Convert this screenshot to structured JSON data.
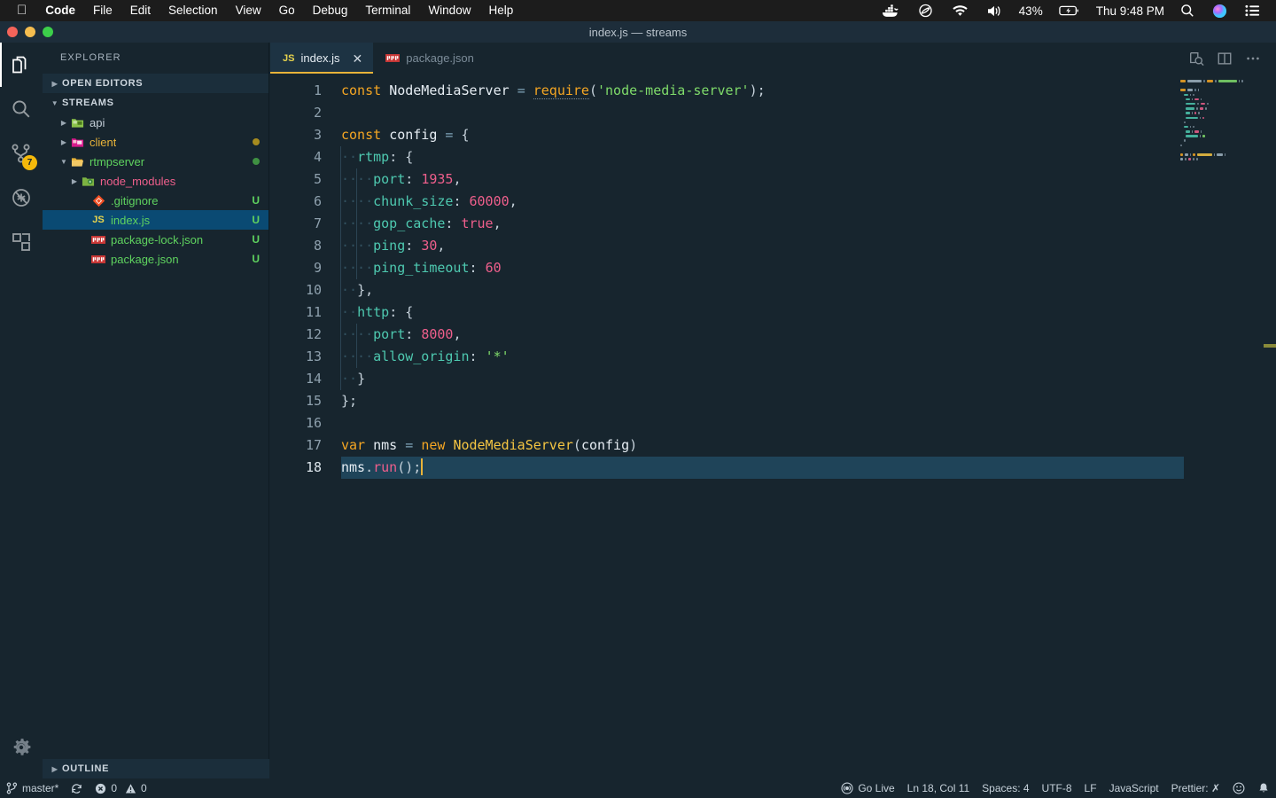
{
  "macos_menubar": {
    "apple_icon": "apple-icon",
    "items": [
      {
        "label": "Code",
        "bold": true
      },
      {
        "label": "File",
        "bold": false
      },
      {
        "label": "Edit",
        "bold": false
      },
      {
        "label": "Selection",
        "bold": false
      },
      {
        "label": "View",
        "bold": false
      },
      {
        "label": "Go",
        "bold": false
      },
      {
        "label": "Debug",
        "bold": false
      },
      {
        "label": "Terminal",
        "bold": false
      },
      {
        "label": "Window",
        "bold": false
      },
      {
        "label": "Help",
        "bold": false
      }
    ],
    "status_icons": [
      "docker-icon",
      "creative-cloud-icon",
      "wifi-icon",
      "volume-icon"
    ],
    "battery_percent": "43%",
    "battery_icon": "battery-charging-icon",
    "clock": "Thu 9:48 PM",
    "right_icons": [
      "spotlight-search-icon",
      "siri-icon",
      "control-center-icon"
    ]
  },
  "window": {
    "title": "index.js — streams",
    "traffic_lights": [
      "close-button",
      "minimize-button",
      "zoom-button"
    ]
  },
  "activity_bar": {
    "items": [
      {
        "name": "explorer",
        "icon": "files-icon",
        "active": true,
        "badge": ""
      },
      {
        "name": "search",
        "icon": "search-icon",
        "active": false,
        "badge": ""
      },
      {
        "name": "source-control",
        "icon": "source-control-icon",
        "active": false,
        "badge": "7"
      },
      {
        "name": "debug",
        "icon": "debug-icon",
        "active": false,
        "badge": ""
      },
      {
        "name": "extensions",
        "icon": "extensions-icon",
        "active": false,
        "badge": ""
      }
    ],
    "settings_icon": "gear-icon"
  },
  "sidebar": {
    "title": "EXPLORER",
    "open_editors_label": "OPEN EDITORS",
    "project_label": "STREAMS",
    "outline_label": "OUTLINE",
    "tree": [
      {
        "label": "api",
        "indent": 1,
        "type": "folder",
        "icon": "folder-api-icon",
        "color": "#c2cdd6",
        "expanded": false,
        "arrow": "collapsed",
        "status": "",
        "dot": ""
      },
      {
        "label": "client",
        "indent": 1,
        "type": "folder",
        "icon": "folder-client-icon",
        "color": "#e8b339",
        "expanded": false,
        "arrow": "collapsed",
        "status": "",
        "dot": "#a68b1f"
      },
      {
        "label": "rtmpserver",
        "indent": 1,
        "type": "folder",
        "icon": "folder-open-icon",
        "color": "#5fd35f",
        "expanded": true,
        "arrow": "expanded",
        "status": "",
        "dot": "#3f9142"
      },
      {
        "label": "node_modules",
        "indent": 2,
        "type": "folder",
        "icon": "folder-node-icon",
        "color": "#ef5f8c",
        "expanded": false,
        "arrow": "collapsed",
        "status": "",
        "dot": ""
      },
      {
        "label": ".gitignore",
        "indent": 3,
        "type": "file",
        "icon": "git-file-icon",
        "color": "#5fd35f",
        "expanded": false,
        "arrow": "none",
        "status": "U",
        "dot": ""
      },
      {
        "label": "index.js",
        "indent": 3,
        "type": "file",
        "icon": "js-file-icon",
        "color": "#5fd35f",
        "expanded": false,
        "arrow": "none",
        "status": "U",
        "dot": "",
        "selected": true
      },
      {
        "label": "package-lock.json",
        "indent": 3,
        "type": "file",
        "icon": "npm-file-icon",
        "color": "#5fd35f",
        "expanded": false,
        "arrow": "none",
        "status": "U",
        "dot": ""
      },
      {
        "label": "package.json",
        "indent": 3,
        "type": "file",
        "icon": "npm-file-icon",
        "color": "#5fd35f",
        "expanded": false,
        "arrow": "none",
        "status": "U",
        "dot": ""
      }
    ]
  },
  "editor": {
    "tabs": [
      {
        "label": "index.js",
        "icon": "js-file-icon",
        "active": true,
        "close_icon": "close-icon"
      },
      {
        "label": "package.json",
        "icon": "npm-file-icon",
        "active": false,
        "close_icon": ""
      }
    ],
    "actions": [
      "open-preview-icon",
      "split-editor-icon",
      "more-actions-icon"
    ],
    "lines": [
      {
        "num": "1",
        "tokens": [
          {
            "t": "const",
            "c": "t-kw"
          },
          {
            "t": " ",
            "c": "t-pun"
          },
          {
            "t": "NodeMediaServer",
            "c": "t-var"
          },
          {
            "t": " ",
            "c": "t-pun"
          },
          {
            "t": "=",
            "c": "t-op"
          },
          {
            "t": " ",
            "c": "t-pun"
          },
          {
            "t": "require",
            "c": "t-req"
          },
          {
            "t": "(",
            "c": "t-pun"
          },
          {
            "t": "'node-media-server'",
            "c": "t-str"
          },
          {
            "t": ")",
            "c": "t-pun"
          },
          {
            "t": ";",
            "c": "t-pun"
          }
        ]
      },
      {
        "num": "2",
        "tokens": []
      },
      {
        "num": "3",
        "tokens": [
          {
            "t": "const",
            "c": "t-kw"
          },
          {
            "t": " ",
            "c": "t-pun"
          },
          {
            "t": "config",
            "c": "t-var"
          },
          {
            "t": " ",
            "c": "t-pun"
          },
          {
            "t": "=",
            "c": "t-op"
          },
          {
            "t": " ",
            "c": "t-pun"
          },
          {
            "t": "{",
            "c": "t-pun"
          }
        ]
      },
      {
        "num": "4",
        "tokens": [
          {
            "t": "··",
            "c": "ws"
          },
          {
            "t": "rtmp",
            "c": "t-prop"
          },
          {
            "t": ":",
            "c": "t-pun"
          },
          {
            "t": " ",
            "c": "t-pun"
          },
          {
            "t": "{",
            "c": "t-pun"
          }
        ]
      },
      {
        "num": "5",
        "tokens": [
          {
            "t": "····",
            "c": "ws"
          },
          {
            "t": "port",
            "c": "t-prop"
          },
          {
            "t": ":",
            "c": "t-pun"
          },
          {
            "t": " ",
            "c": "t-pun"
          },
          {
            "t": "1935",
            "c": "t-num"
          },
          {
            "t": ",",
            "c": "t-pun"
          }
        ]
      },
      {
        "num": "6",
        "tokens": [
          {
            "t": "····",
            "c": "ws"
          },
          {
            "t": "chunk_size",
            "c": "t-prop"
          },
          {
            "t": ":",
            "c": "t-pun"
          },
          {
            "t": " ",
            "c": "t-pun"
          },
          {
            "t": "60000",
            "c": "t-num"
          },
          {
            "t": ",",
            "c": "t-pun"
          }
        ]
      },
      {
        "num": "7",
        "tokens": [
          {
            "t": "····",
            "c": "ws"
          },
          {
            "t": "gop_cache",
            "c": "t-prop"
          },
          {
            "t": ":",
            "c": "t-pun"
          },
          {
            "t": " ",
            "c": "t-pun"
          },
          {
            "t": "true",
            "c": "t-num"
          },
          {
            "t": ",",
            "c": "t-pun"
          }
        ]
      },
      {
        "num": "8",
        "tokens": [
          {
            "t": "····",
            "c": "ws"
          },
          {
            "t": "ping",
            "c": "t-prop"
          },
          {
            "t": ":",
            "c": "t-pun"
          },
          {
            "t": " ",
            "c": "t-pun"
          },
          {
            "t": "30",
            "c": "t-num"
          },
          {
            "t": ",",
            "c": "t-pun"
          }
        ]
      },
      {
        "num": "9",
        "tokens": [
          {
            "t": "····",
            "c": "ws"
          },
          {
            "t": "ping_timeout",
            "c": "t-prop"
          },
          {
            "t": ":",
            "c": "t-pun"
          },
          {
            "t": " ",
            "c": "t-pun"
          },
          {
            "t": "60",
            "c": "t-num"
          }
        ]
      },
      {
        "num": "10",
        "tokens": [
          {
            "t": "··",
            "c": "ws"
          },
          {
            "t": "},",
            "c": "t-pun"
          }
        ]
      },
      {
        "num": "11",
        "tokens": [
          {
            "t": "··",
            "c": "ws"
          },
          {
            "t": "http",
            "c": "t-prop"
          },
          {
            "t": ":",
            "c": "t-pun"
          },
          {
            "t": " ",
            "c": "t-pun"
          },
          {
            "t": "{",
            "c": "t-pun"
          }
        ]
      },
      {
        "num": "12",
        "tokens": [
          {
            "t": "····",
            "c": "ws"
          },
          {
            "t": "port",
            "c": "t-prop"
          },
          {
            "t": ":",
            "c": "t-pun"
          },
          {
            "t": " ",
            "c": "t-pun"
          },
          {
            "t": "8000",
            "c": "t-num"
          },
          {
            "t": ",",
            "c": "t-pun"
          }
        ]
      },
      {
        "num": "13",
        "tokens": [
          {
            "t": "····",
            "c": "ws"
          },
          {
            "t": "allow_origin",
            "c": "t-prop"
          },
          {
            "t": ":",
            "c": "t-pun"
          },
          {
            "t": " ",
            "c": "t-pun"
          },
          {
            "t": "'*'",
            "c": "t-str"
          }
        ]
      },
      {
        "num": "14",
        "tokens": [
          {
            "t": "··",
            "c": "ws"
          },
          {
            "t": "}",
            "c": "t-pun"
          }
        ]
      },
      {
        "num": "15",
        "tokens": [
          {
            "t": "};",
            "c": "t-pun"
          }
        ]
      },
      {
        "num": "16",
        "tokens": []
      },
      {
        "num": "17",
        "tokens": [
          {
            "t": "var",
            "c": "t-kw"
          },
          {
            "t": " ",
            "c": "t-pun"
          },
          {
            "t": "nms",
            "c": "t-var"
          },
          {
            "t": " ",
            "c": "t-pun"
          },
          {
            "t": "=",
            "c": "t-op"
          },
          {
            "t": " ",
            "c": "t-pun"
          },
          {
            "t": "new",
            "c": "t-kw"
          },
          {
            "t": " ",
            "c": "t-pun"
          },
          {
            "t": "NodeMediaServer",
            "c": "t-fn"
          },
          {
            "t": "(",
            "c": "t-pun"
          },
          {
            "t": "config",
            "c": "t-var"
          },
          {
            "t": ")",
            "c": "t-pun"
          }
        ]
      },
      {
        "num": "18",
        "current": true,
        "tokens": [
          {
            "t": "nms",
            "c": "t-var"
          },
          {
            "t": ".",
            "c": "t-pun"
          },
          {
            "t": "run",
            "c": "t-meth"
          },
          {
            "t": "()",
            "c": "t-pun"
          },
          {
            "t": ";",
            "c": "t-pun"
          }
        ]
      }
    ]
  },
  "status_bar": {
    "left": [
      {
        "name": "branch",
        "icon": "source-control-icon",
        "label": "master*"
      },
      {
        "name": "sync",
        "icon": "sync-icon",
        "label": ""
      },
      {
        "name": "errors",
        "icon": "error-icon",
        "label": "0"
      },
      {
        "name": "warnings",
        "icon": "warning-icon",
        "label": "0"
      }
    ],
    "right": [
      {
        "name": "go-live",
        "icon": "broadcast-icon",
        "label": "Go Live"
      },
      {
        "name": "cursor-position",
        "icon": "",
        "label": "Ln 18, Col 11"
      },
      {
        "name": "indentation",
        "icon": "",
        "label": "Spaces: 4"
      },
      {
        "name": "encoding",
        "icon": "",
        "label": "UTF-8"
      },
      {
        "name": "eol",
        "icon": "",
        "label": "LF"
      },
      {
        "name": "language-mode",
        "icon": "",
        "label": "JavaScript"
      },
      {
        "name": "prettier",
        "icon": "",
        "label": "Prettier: ✗"
      },
      {
        "name": "feedback",
        "icon": "smiley-icon",
        "label": ""
      },
      {
        "name": "notifications",
        "icon": "bell-icon",
        "label": ""
      }
    ]
  },
  "colors": {
    "background": "#17252e",
    "sidebar_selection": "#0a4a73",
    "tab_active_border": "#e8b339",
    "current_line": "#1f4459",
    "badge": "#f5b90a"
  }
}
